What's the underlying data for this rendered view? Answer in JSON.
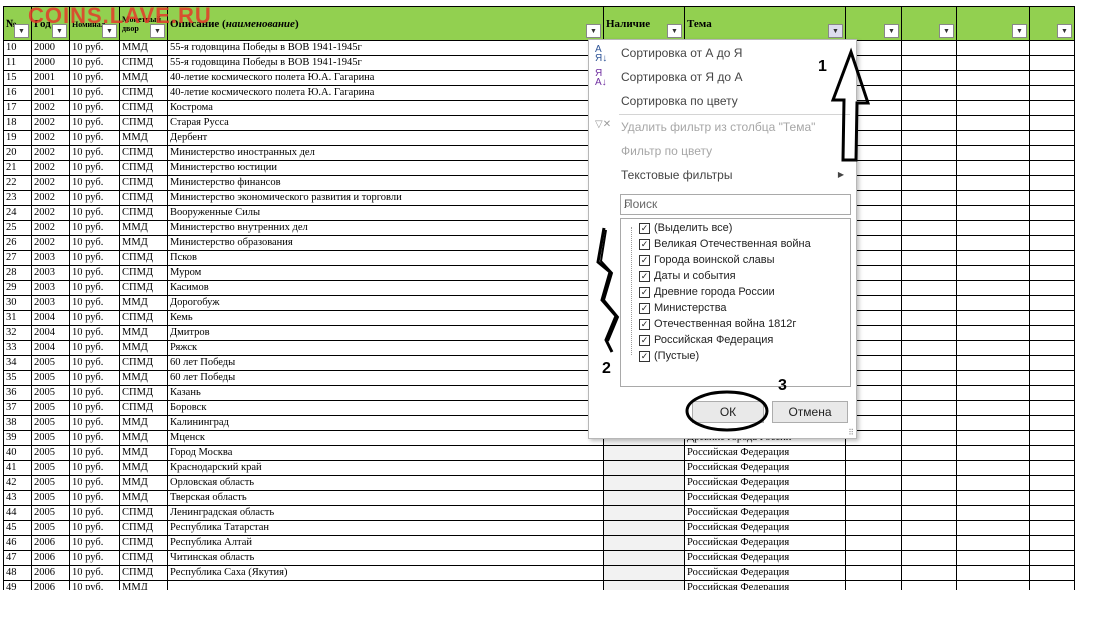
{
  "watermark": "COINS.LAVE.RU",
  "headers": {
    "num": "№",
    "year": "Год",
    "nominal": "Номинал",
    "mint": "Монетный двор",
    "desc_prefix": "Описание (",
    "desc_italic": "наименование",
    "desc_suffix": ")",
    "avail": "Наличие",
    "theme": "Тема"
  },
  "rows": [
    [
      "10",
      "2000",
      "10 руб.",
      "ММД",
      "55-я годовщина Победы в ВОВ 1941-1945г",
      ""
    ],
    [
      "11",
      "2000",
      "10 руб.",
      "СПМД",
      "55-я годовщина Победы в ВОВ 1941-1945г",
      ""
    ],
    [
      "15",
      "2001",
      "10 руб.",
      "ММД",
      "40-летие космического полета Ю.А. Гагарина",
      ""
    ],
    [
      "16",
      "2001",
      "10 руб.",
      "СПМД",
      "40-летие космического полета Ю.А. Гагарина",
      ""
    ],
    [
      "17",
      "2002",
      "10 руб.",
      "СПМД",
      "Кострома",
      ""
    ],
    [
      "18",
      "2002",
      "10 руб.",
      "СПМД",
      "Старая Русса",
      ""
    ],
    [
      "19",
      "2002",
      "10 руб.",
      "ММД",
      "Дербент",
      ""
    ],
    [
      "20",
      "2002",
      "10 руб.",
      "СПМД",
      "Министерство иностранных дел",
      ""
    ],
    [
      "21",
      "2002",
      "10 руб.",
      "СПМД",
      "Министерство юстиции",
      ""
    ],
    [
      "22",
      "2002",
      "10 руб.",
      "СПМД",
      "Министерство финансов",
      ""
    ],
    [
      "23",
      "2002",
      "10 руб.",
      "СПМД",
      "Министерство экономического развития и торговли",
      ""
    ],
    [
      "24",
      "2002",
      "10 руб.",
      "СПМД",
      "Вооруженные Силы",
      ""
    ],
    [
      "25",
      "2002",
      "10 руб.",
      "ММД",
      "Министерство внутренних дел",
      ""
    ],
    [
      "26",
      "2002",
      "10 руб.",
      "ММД",
      "Министерство образования",
      ""
    ],
    [
      "27",
      "2003",
      "10 руб.",
      "СПМД",
      "Псков",
      ""
    ],
    [
      "28",
      "2003",
      "10 руб.",
      "СПМД",
      "Муром",
      ""
    ],
    [
      "29",
      "2003",
      "10 руб.",
      "СПМД",
      "Касимов",
      ""
    ],
    [
      "30",
      "2003",
      "10 руб.",
      "ММД",
      "Дорогобуж",
      ""
    ],
    [
      "31",
      "2004",
      "10 руб.",
      "СПМД",
      "Кемь",
      ""
    ],
    [
      "32",
      "2004",
      "10 руб.",
      "ММД",
      "Дмитров",
      ""
    ],
    [
      "33",
      "2004",
      "10 руб.",
      "ММД",
      "Ряжск",
      ""
    ],
    [
      "34",
      "2005",
      "10 руб.",
      "СПМД",
      "60 лет Победы",
      ""
    ],
    [
      "35",
      "2005",
      "10 руб.",
      "ММД",
      "60 лет Победы",
      ""
    ],
    [
      "36",
      "2005",
      "10 руб.",
      "СПМД",
      "Казань",
      ""
    ],
    [
      "37",
      "2005",
      "10 руб.",
      "СПМД",
      "Боровск",
      ""
    ],
    [
      "38",
      "2005",
      "10 руб.",
      "ММД",
      "Калининград",
      ""
    ],
    [
      "39",
      "2005",
      "10 руб.",
      "ММД",
      "Мценск",
      "Древние города России"
    ],
    [
      "40",
      "2005",
      "10 руб.",
      "ММД",
      "Город Москва",
      "Российская Федерация"
    ],
    [
      "41",
      "2005",
      "10 руб.",
      "ММД",
      "Краснодарский край",
      "Российская Федерация"
    ],
    [
      "42",
      "2005",
      "10 руб.",
      "ММД",
      "Орловская область",
      "Российская Федерация"
    ],
    [
      "43",
      "2005",
      "10 руб.",
      "ММД",
      "Тверская область",
      "Российская Федерация"
    ],
    [
      "44",
      "2005",
      "10 руб.",
      "СПМД",
      "Ленинградская область",
      "Российская Федерация"
    ],
    [
      "45",
      "2005",
      "10 руб.",
      "СПМД",
      "Республика Татарстан",
      "Российская Федерация"
    ],
    [
      "46",
      "2006",
      "10 руб.",
      "СПМД",
      "Республика Алтай",
      "Российская Федерация"
    ],
    [
      "47",
      "2006",
      "10 руб.",
      "СПМД",
      "Читинская область",
      "Российская Федерация"
    ],
    [
      "48",
      "2006",
      "10 руб.",
      "СПМД",
      "Республика Саха (Якутия)",
      "Российская Федерация"
    ],
    [
      "49",
      "2006",
      "10 руб.",
      "ММД",
      "",
      "Российская Федерация"
    ]
  ],
  "filter": {
    "sort_az": "Сортировка от А до Я",
    "sort_za": "Сортировка от Я до А",
    "sort_color": "Сортировка по цвету",
    "clear_filter": "Удалить фильтр из столбца \"Тема\"",
    "filter_color": "Фильтр по цвету",
    "text_filters": "Текстовые фильтры",
    "search_placeholder": "Поиск",
    "items": [
      {
        "label": "(Выделить все)",
        "checked": true
      },
      {
        "label": "Великая Отечественная война",
        "checked": true
      },
      {
        "label": "Города воинской славы",
        "checked": true
      },
      {
        "label": "Даты и события",
        "checked": true
      },
      {
        "label": "Древние города России",
        "checked": true
      },
      {
        "label": "Министерства",
        "checked": true
      },
      {
        "label": "Отечественная война 1812г",
        "checked": true
      },
      {
        "label": "Российская Федерация",
        "checked": true
      },
      {
        "label": "(Пустые)",
        "checked": true
      }
    ],
    "ok": "ОК",
    "cancel": "Отмена"
  },
  "annotations": {
    "n1": "1",
    "n2": "2",
    "n3": "3"
  },
  "colors": {
    "header_bg": "#92d050",
    "watermark": "#e53a2a"
  },
  "icons": [
    "sort-asc-icon",
    "sort-desc-icon",
    "clear-filter-icon",
    "search-icon",
    "dropdown-arrow-icon",
    "submenu-arrow-icon"
  ]
}
